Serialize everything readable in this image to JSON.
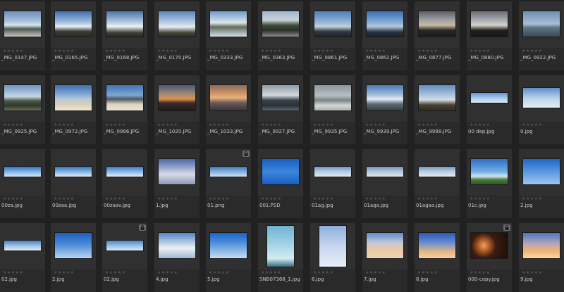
{
  "app": {
    "view": "thumbnail-grid"
  },
  "colors": {
    "background": "#212121",
    "cell": "#2a2a2a",
    "label": "#c8c8c8",
    "stars": "#555555"
  },
  "rows": [
    {
      "items": [
        {
          "name": "_MG_0147.JPG",
          "stars": "★★★★★",
          "locked": false,
          "thumb": "linear-gradient(#6c8fb8 0%, #a9c3de 40%, #d9e4ec 55%, #4b5a52 70%, #c8c8c0 100%)",
          "aspect": "landscape"
        },
        {
          "name": "_MG_0165.JPG",
          "stars": "★★★★★",
          "locked": false,
          "thumb": "linear-gradient(#3f6fb0 0%, #a8c2e0 45%, #e9eef2 60%, #3a3a32 80%, #2c2a24 100%)",
          "aspect": "landscape"
        },
        {
          "name": "_MG_0168.JPG",
          "stars": "★★★★★",
          "locked": false,
          "thumb": "linear-gradient(#4a74aa 0%, #b9cde3 45%, #eef2f5 60%, #3e3c34 85%, #2a2822 100%)",
          "aspect": "landscape"
        },
        {
          "name": "_MG_0170.JPG",
          "stars": "★★★★★",
          "locked": false,
          "thumb": "linear-gradient(#5a86be 0%, #c5d6e8 50%, #e9edf0 62%, #474437 85%, #2e2c26 100%)",
          "aspect": "landscape"
        },
        {
          "name": "_MG_0333.JPG",
          "stars": "★★★★★",
          "locked": false,
          "thumb": "linear-gradient(#6d99c9 0%, #dde7ef 45%, #6a6a55 62%, #95a2aa 80%, #d8dde0 100%)",
          "aspect": "landscape"
        },
        {
          "name": "_MG_0363.JPG",
          "stars": "★★★★★",
          "locked": false,
          "thumb": "linear-gradient(#9fb7cf 0%, #c9d3d9 35%, #3e4d3a 55%, #2b2e28 75%, #8a8f8e 100%)",
          "aspect": "landscape"
        },
        {
          "name": "_MG_0861.JPG",
          "stars": "★★★★★",
          "locked": false,
          "thumb": "linear-gradient(#4c7fb8 0%, #98b7d6 45%, #c8d2da 60%, #2f3a44 80%, #1e2228 100%)",
          "aspect": "landscape"
        },
        {
          "name": "_MG_0862.JPG",
          "stars": "★★★★★",
          "locked": false,
          "thumb": "linear-gradient(#3a6fb2 0%, #88aed8 45%, #b8c9da 60%, #27323f 82%, #1c2129 100%)",
          "aspect": "landscape"
        },
        {
          "name": "_MG_0877.JPG",
          "stars": "★★★★★",
          "locked": false,
          "thumb": "linear-gradient(#5b5f66 0%, #9ea2a4 35%, #cbbca0 55%, #2a2824 75%, #1c1b19 100%)",
          "aspect": "landscape"
        },
        {
          "name": "_MG_0880.JPG",
          "stars": "★★★★★",
          "locked": false,
          "thumb": "linear-gradient(#6a6f78 0%, #b3b6b8 40%, #d6d3c9 55%, #22221f 75%, #161614 100%)",
          "aspect": "landscape"
        },
        {
          "name": "_MG_0922.JPG",
          "stars": "★★★★★",
          "locked": false,
          "thumb": "linear-gradient(#6d8fb0 0%, #a7bfd3 50%, #5f7482 65%, #3a4a55 100%)",
          "aspect": "landscape"
        }
      ]
    },
    {
      "items": [
        {
          "name": "_MG_0925.JPG",
          "stars": "★★★★★",
          "locked": false,
          "thumb": "linear-gradient(#6b93c2 0%, #c9d8e6 45%, #4a5a48 62%, #2c3a2c 80%, #6b6a5a 100%)",
          "aspect": "landscape"
        },
        {
          "name": "_MG_0972.JPG",
          "stars": "★★★★★",
          "locked": false,
          "thumb": "linear-gradient(#3d6eb0 0%, #7fa6d2 35%, #b7c9da 55%, #d8cfb8 75%, #efe7d2 100%)",
          "aspect": "landscape"
        },
        {
          "name": "_MG_0986.JPG",
          "stars": "★★★★★",
          "locked": false,
          "thumb": "linear-gradient(#3f74b4 0%, #7ea7d3 40%, #4a5a5c 55%, #d9d2c0 75%, #ece6d6 100%)",
          "aspect": "landscape"
        },
        {
          "name": "_MG_1020.JPG",
          "stars": "★★★★★",
          "locked": false,
          "thumb": "linear-gradient(#4a5a78 0%, #a08a78 35%, #e0904a 55%, #3a2c2a 70%, #1e1b1c 100%)",
          "aspect": "landscape"
        },
        {
          "name": "_MG_1033.JPG",
          "stars": "★★★★★",
          "locked": false,
          "thumb": "linear-gradient(#8b6a5a 0%, #d39a6a 35%, #e8b07a 50%, #6a5a58 70%, #3a3434 100%)",
          "aspect": "landscape"
        },
        {
          "name": "_MG_9927.JPG",
          "stars": "★★★★★",
          "locked": false,
          "thumb": "linear-gradient(#8c9aa4 0%, #d4dadd 40%, #3a4148 60%, #2a3036 80%, #5a6a78 100%)",
          "aspect": "landscape"
        },
        {
          "name": "_MG_9935.JPG",
          "stars": "★★★★★",
          "locked": false,
          "thumb": "linear-gradient(#8e969c 0%, #b9bfc2 40%, #7b8388 60%, #d6d8d6 80%, #a9aeb0 100%)",
          "aspect": "landscape"
        },
        {
          "name": "_MG_9939.JPG",
          "stars": "★★★★★",
          "locked": false,
          "thumb": "linear-gradient(#4a79b6 0%, #a6c0dc 40%, #e5ecf0 55%, #5a6a72 75%, #3a3e3c 100%)",
          "aspect": "landscape"
        },
        {
          "name": "_MG_9988.JPG",
          "stars": "★★★★★",
          "locked": false,
          "thumb": "linear-gradient(#5f8cc2 0%, #b7cbe0 45%, #d5dde2 58%, #4a4238 78%, #2e2a24 100%)",
          "aspect": "landscape"
        },
        {
          "name": "00 dep.jpg",
          "stars": "★★★★★",
          "locked": false,
          "thumb": "linear-gradient(#5e93d6 0%, #a6c8ea 50%, #dfeaf4 100%)",
          "aspect": "pano"
        },
        {
          "name": "0.jpg",
          "stars": "★★★★★",
          "locked": false,
          "thumb": "linear-gradient(#5d8ec8 0%, #b8d0e8 50%, #e4eef6 100%)",
          "aspect": "wide"
        }
      ]
    },
    {
      "items": [
        {
          "name": "00za.jpg",
          "stars": "★★★★★",
          "locked": false,
          "thumb": "linear-gradient(#2f74c8 0%, #78aee2 45%, #d7e8f4 100%)",
          "aspect": "pano"
        },
        {
          "name": "00zaa.jpg",
          "stars": "★★★★★",
          "locked": false,
          "thumb": "linear-gradient(#3576c6 0%, #83b3e2 50%, #e0ecf5 100%)",
          "aspect": "pano"
        },
        {
          "name": "00zaav.jpg",
          "stars": "★★★★★",
          "locked": false,
          "thumb": "linear-gradient(#3a7ac8 0%, #8ab8e4 50%, #e2edf6 100%)",
          "aspect": "pano"
        },
        {
          "name": "1.jpg",
          "stars": "★★★★★",
          "locked": false,
          "thumb": "linear-gradient(#4b66a8 0%, #9aa8cf 35%, #d8dbe8 60%, #8e9ab8 100%)",
          "aspect": "landscape"
        },
        {
          "name": "01.png",
          "stars": "★★★★★",
          "locked": true,
          "thumb": "linear-gradient(#3e78c0 0%, #86b0dc 50%, #cfe0ef 100%)",
          "aspect": "pano"
        },
        {
          "name": "001.PSD",
          "stars": "★★★★★",
          "locked": false,
          "thumb": "linear-gradient(#1a5fc4 0%, #3a86dc 50%, #1a5fc4 100%)",
          "aspect": "landscape"
        },
        {
          "name": "01ag.jpg",
          "stars": "★★★★★",
          "locked": false,
          "thumb": "linear-gradient(#6d97c6 0%, #b7cde2 50%, #dfe8ef 100%)",
          "aspect": "pano"
        },
        {
          "name": "01aga.jpg",
          "stars": "★★★★★",
          "locked": false,
          "thumb": "linear-gradient(#6e95c0 0%, #b5c9dc 50%, #dde5ec 100%)",
          "aspect": "pano"
        },
        {
          "name": "01agaa.jpg",
          "stars": "★★★★★",
          "locked": false,
          "thumb": "linear-gradient(#7399c4 0%, #bcd0e2 50%, #e2e9ef 100%)",
          "aspect": "pano"
        },
        {
          "name": "01c.jpg",
          "stars": "★★★★★",
          "locked": false,
          "thumb": "linear-gradient(#2e6fc6 0%, #74aee4 50%, #cfe4f0 68%, #4a7a3a 82%, #2f5a2a 100%)",
          "aspect": "landscape"
        },
        {
          "name": "2.jpg",
          "stars": "★★★★★",
          "locked": false,
          "thumb": "linear-gradient(#1f66c8 0%, #5a9ae0 50%, #9cc6ee 100%)",
          "aspect": "landscape"
        }
      ]
    },
    {
      "items": [
        {
          "name": "02.jpg",
          "stars": "★★★★★",
          "locked": false,
          "thumb": "linear-gradient(#4a82c4 0%, #9cc0e2 50%, #e0ebf4 100%)",
          "aspect": "pano"
        },
        {
          "name": "2.jpg",
          "stars": "★★★★★",
          "locked": false,
          "thumb": "linear-gradient(#1e5fc0 0%, #4b8ad8 45%, #b8d4ee 100%)",
          "aspect": "landscape"
        },
        {
          "name": "02.jpg",
          "stars": "★★★★★",
          "locked": true,
          "thumb": "linear-gradient(#4a86c8 0%, #96bfe4 50%, #dbe8f3 100%)",
          "aspect": "pano"
        },
        {
          "name": "4.jpg",
          "stars": "★★★★★",
          "locked": false,
          "thumb": "linear-gradient(#5686c2 0%, #b7cde4 40%, #eef2f6 60%, #9fb8d4 100%)",
          "aspect": "landscape"
        },
        {
          "name": "5.jpg",
          "stars": "★★★★★",
          "locked": false,
          "thumb": "linear-gradient(#1a62c8 0%, #4f90dc 40%, #c8ddf0 100%)",
          "aspect": "landscape"
        },
        {
          "name": "SNB07368_1.jpg",
          "stars": "★★★★★",
          "locked": false,
          "thumb": "linear-gradient(#6fb2d4 0%, #a8d6e6 50%, #d2ecf2 80%, #3a6a7a 100%)",
          "aspect": "portrait"
        },
        {
          "name": "6.jpg",
          "stars": "★★★★★",
          "locked": false,
          "thumb": "linear-gradient(#8eaedc 0%, #c6d6ee 50%, #e8eef8 100%)",
          "aspect": "portrait"
        },
        {
          "name": "7.jpg",
          "stars": "★★★★★",
          "locked": false,
          "thumb": "linear-gradient(#5e8ec8 0%, #c6c8d8 40%, #f0c8a0 70%, #e8d4c0 100%)",
          "aspect": "landscape"
        },
        {
          "name": "8.jpg",
          "stars": "★★★★★",
          "locked": false,
          "thumb": "linear-gradient(#2a5ab8 0%, #6a8ed0 40%, #e8b880 75%, #f2d0a8 100%)",
          "aspect": "landscape"
        },
        {
          "name": "000-copy.jpg",
          "stars": "★★★★★",
          "locked": true,
          "thumb": "radial-gradient(circle at 35% 50%, #f0a060 0%, #a05020 25%, #3a1c10 45%, #1a0e08 100%)",
          "aspect": "landscape"
        },
        {
          "name": "9.jpg",
          "stars": "★★★★★",
          "locked": false,
          "thumb": "linear-gradient(#4a78c0 0%, #b8a8b8 45%, #f0b070 70%, #f8d8a8 100%)",
          "aspect": "landscape"
        }
      ]
    }
  ]
}
